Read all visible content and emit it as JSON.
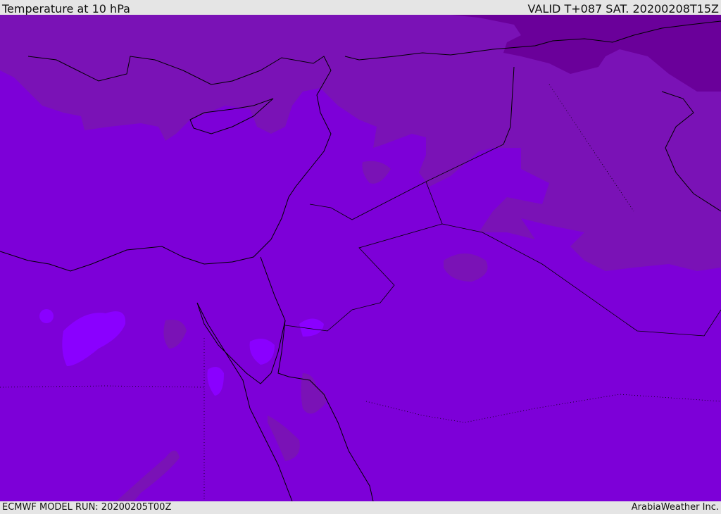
{
  "header": {
    "title": "Temperature at 10 hPa",
    "valid_time": "VALID T+087 SAT. 20200208T15Z"
  },
  "footer": {
    "model_run": "ECMWF MODEL RUN: 20200205T00Z",
    "credit": "ArabiaWeather Inc."
  },
  "colors": {
    "base": "#7d00d8",
    "cool_band": "#7a12b6",
    "coldest": "#6a009a",
    "warm_patch": "#8a00ff",
    "coast": "#000000"
  }
}
